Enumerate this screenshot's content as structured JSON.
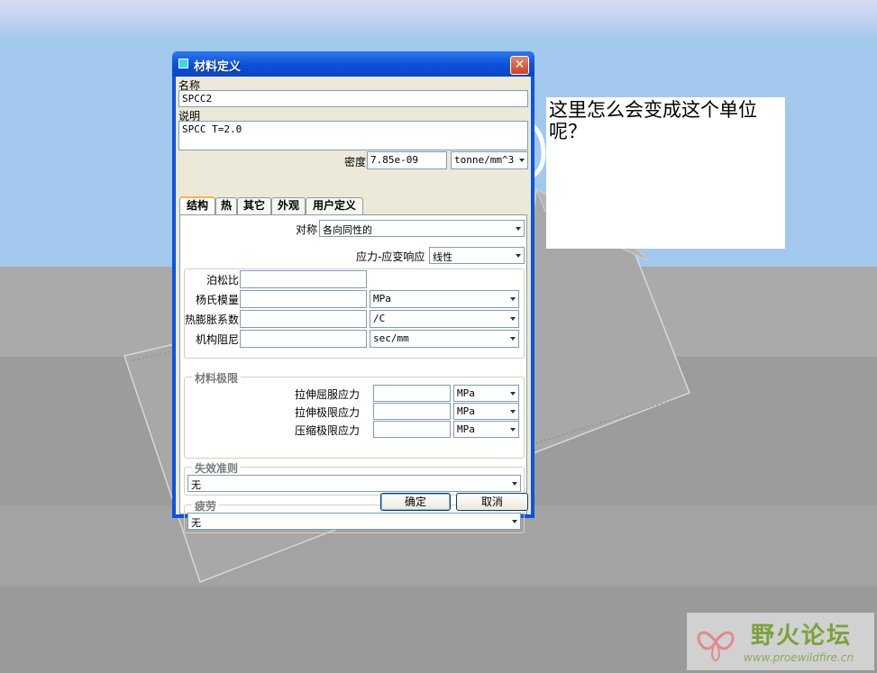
{
  "dialog": {
    "title": "材料定义",
    "close_glyph": "✕",
    "name_label": "名称",
    "name_value": "SPCC2",
    "desc_label": "说明",
    "desc_value": "SPCC T=2.0",
    "density_label": "密度",
    "density_value": "7.85e-09",
    "density_unit": "tonne/mm^3",
    "tabs": [
      "结构",
      "热",
      "其它",
      "外观",
      "用户定义"
    ],
    "active_tab": "结构",
    "symmetry_label": "对称",
    "symmetry_value": "各向同性的",
    "stress_strain_label": "应力-应变响应",
    "stress_strain_value": "线性",
    "props": [
      {
        "label": "泊松比",
        "value": "",
        "unit": ""
      },
      {
        "label": "杨氏模量",
        "value": "",
        "unit": "MPa"
      },
      {
        "label": "热膨胀系数",
        "value": "",
        "unit": "/C"
      },
      {
        "label": "机构阻尼",
        "value": "",
        "unit": "sec/mm"
      }
    ],
    "limits_title": "材料极限",
    "limits": [
      {
        "label": "拉伸屈服应力",
        "value": "",
        "unit": "MPa"
      },
      {
        "label": "拉伸极限应力",
        "value": "",
        "unit": "MPa"
      },
      {
        "label": "压缩极限应力",
        "value": "",
        "unit": "MPa"
      }
    ],
    "failure_title": "失效准则",
    "failure_value": "无",
    "fatigue_title": "疲劳",
    "fatigue_value": "无",
    "ok_label": "确定",
    "cancel_label": "取消"
  },
  "annotation": {
    "text": "这里怎么会变成这个单位呢？"
  },
  "watermark": {
    "name": "野火论坛",
    "url": "www.proewildfire.cn"
  },
  "colors": {
    "sky": "#a3c8ee",
    "titlebar": "#0a55e0",
    "dialog_face": "#ece9d8",
    "close_button": "#d2401e"
  }
}
